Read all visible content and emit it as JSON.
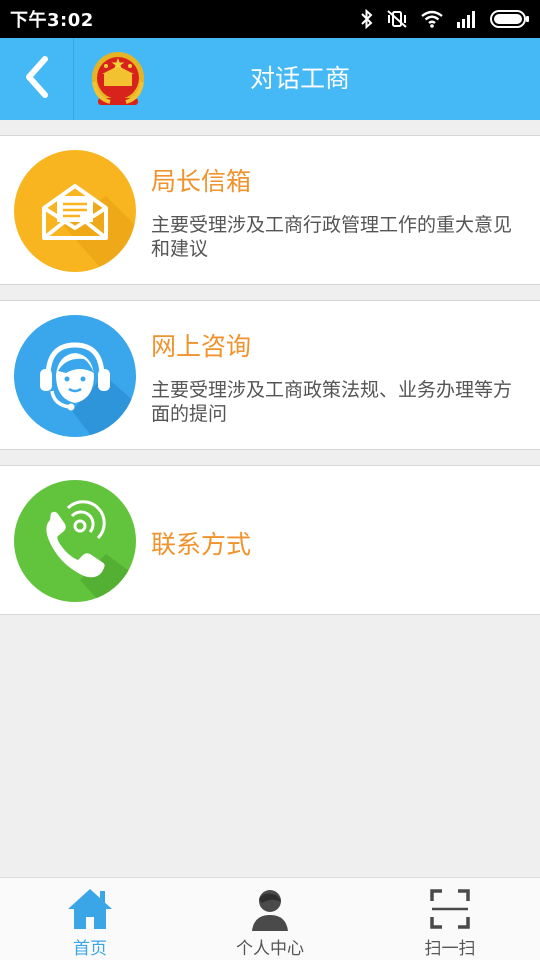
{
  "status_bar": {
    "time": "下午3:02",
    "icons": [
      "bluetooth-icon",
      "vibrate-off-icon",
      "wifi-icon",
      "signal-icon",
      "battery-icon"
    ]
  },
  "header": {
    "title": "对话工商",
    "back_icon": "chevron-left-icon",
    "emblem_icon": "national-emblem-icon",
    "background": "#45b9f5"
  },
  "menu": [
    {
      "title": "局长信箱",
      "description": "主要受理涉及工商行政管理工作的重大意见和建议",
      "icon": "envelope-icon",
      "color": "#f8b51f"
    },
    {
      "title": "网上咨询",
      "description": "主要受理涉及工商政策法规、业务办理等方面的提问",
      "icon": "headset-agent-icon",
      "color": "#3aa6ec"
    },
    {
      "title": "联系方式",
      "description": "",
      "icon": "phone-icon",
      "color": "#62c33d"
    }
  ],
  "colors": {
    "accent": "#45b9f5",
    "title_orange": "#f0932c",
    "nav_active": "#3aa6e8"
  },
  "bottom_nav": [
    {
      "label": "首页",
      "icon": "home-icon",
      "active": true
    },
    {
      "label": "个人中心",
      "icon": "user-icon",
      "active": false
    },
    {
      "label": "扫一扫",
      "icon": "scan-icon",
      "active": false
    }
  ]
}
